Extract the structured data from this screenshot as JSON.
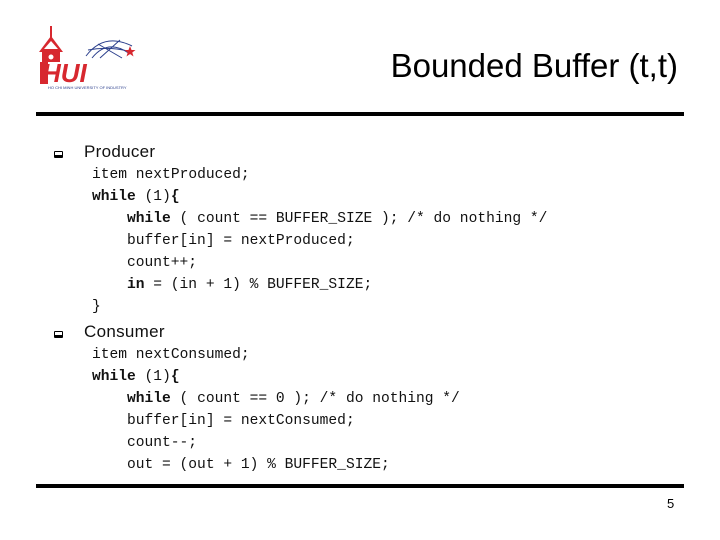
{
  "slide": {
    "title": "Bounded Buffer (t,t)",
    "page_number": "5",
    "logo": {
      "icon": "hui-university-logo",
      "text": "HUI",
      "subtitle": "HO CHI MINH UNIVERSITY OF INDUSTRY",
      "brand_color": "#d7282f",
      "globe_color": "#2b3f8c"
    },
    "sections": [
      {
        "heading": "Producer",
        "bullet_icon": "square-bullet-icon",
        "lines": [
          {
            "indent": 0,
            "parts": [
              {
                "text": "item nextProduced;",
                "bold": false
              }
            ]
          },
          {
            "indent": 0,
            "parts": [
              {
                "text": "while",
                "bold": true
              },
              {
                "text": " (1)",
                "bold": false
              },
              {
                "text": "{",
                "bold": true
              }
            ]
          },
          {
            "indent": 1,
            "parts": [
              {
                "text": "while",
                "bold": true
              },
              {
                "text": " ( count == ",
                "bold": false
              },
              {
                "text": "BUFFER_SIZE",
                "bold": false
              },
              {
                "text": " ); /* do nothing */",
                "bold": false
              }
            ]
          },
          {
            "indent": 1,
            "parts": [
              {
                "text": "buffer[in] = nextProduced;",
                "bold": false
              }
            ]
          },
          {
            "indent": 1,
            "parts": [
              {
                "text": "count++;",
                "bold": false
              }
            ]
          },
          {
            "indent": 1,
            "parts": [
              {
                "text": "in",
                "bold": true
              },
              {
                "text": " = (in + 1) % BUFFER_SIZE;",
                "bold": false
              }
            ]
          },
          {
            "indent": 0,
            "parts": [
              {
                "text": "}",
                "bold": false
              }
            ]
          }
        ]
      },
      {
        "heading": "Consumer",
        "bullet_icon": "square-bullet-icon",
        "lines": [
          {
            "indent": 0,
            "parts": [
              {
                "text": "item nextConsumed;",
                "bold": false
              }
            ]
          },
          {
            "indent": 0,
            "parts": [
              {
                "text": "while",
                "bold": true
              },
              {
                "text": " (1)",
                "bold": false
              },
              {
                "text": "{",
                "bold": true
              }
            ]
          },
          {
            "indent": 1,
            "parts": [
              {
                "text": "while",
                "bold": true
              },
              {
                "text": " ( count == 0 ); /* do nothing */",
                "bold": false
              }
            ]
          },
          {
            "indent": 1,
            "parts": [
              {
                "text": "buffer[in] = nextConsumed;",
                "bold": false
              }
            ]
          },
          {
            "indent": 1,
            "parts": [
              {
                "text": "count--;",
                "bold": false
              }
            ]
          },
          {
            "indent": 1,
            "parts": [
              {
                "text": "out = (out + 1) % BUFFER_SIZE;",
                "bold": false
              }
            ]
          }
        ]
      }
    ]
  }
}
